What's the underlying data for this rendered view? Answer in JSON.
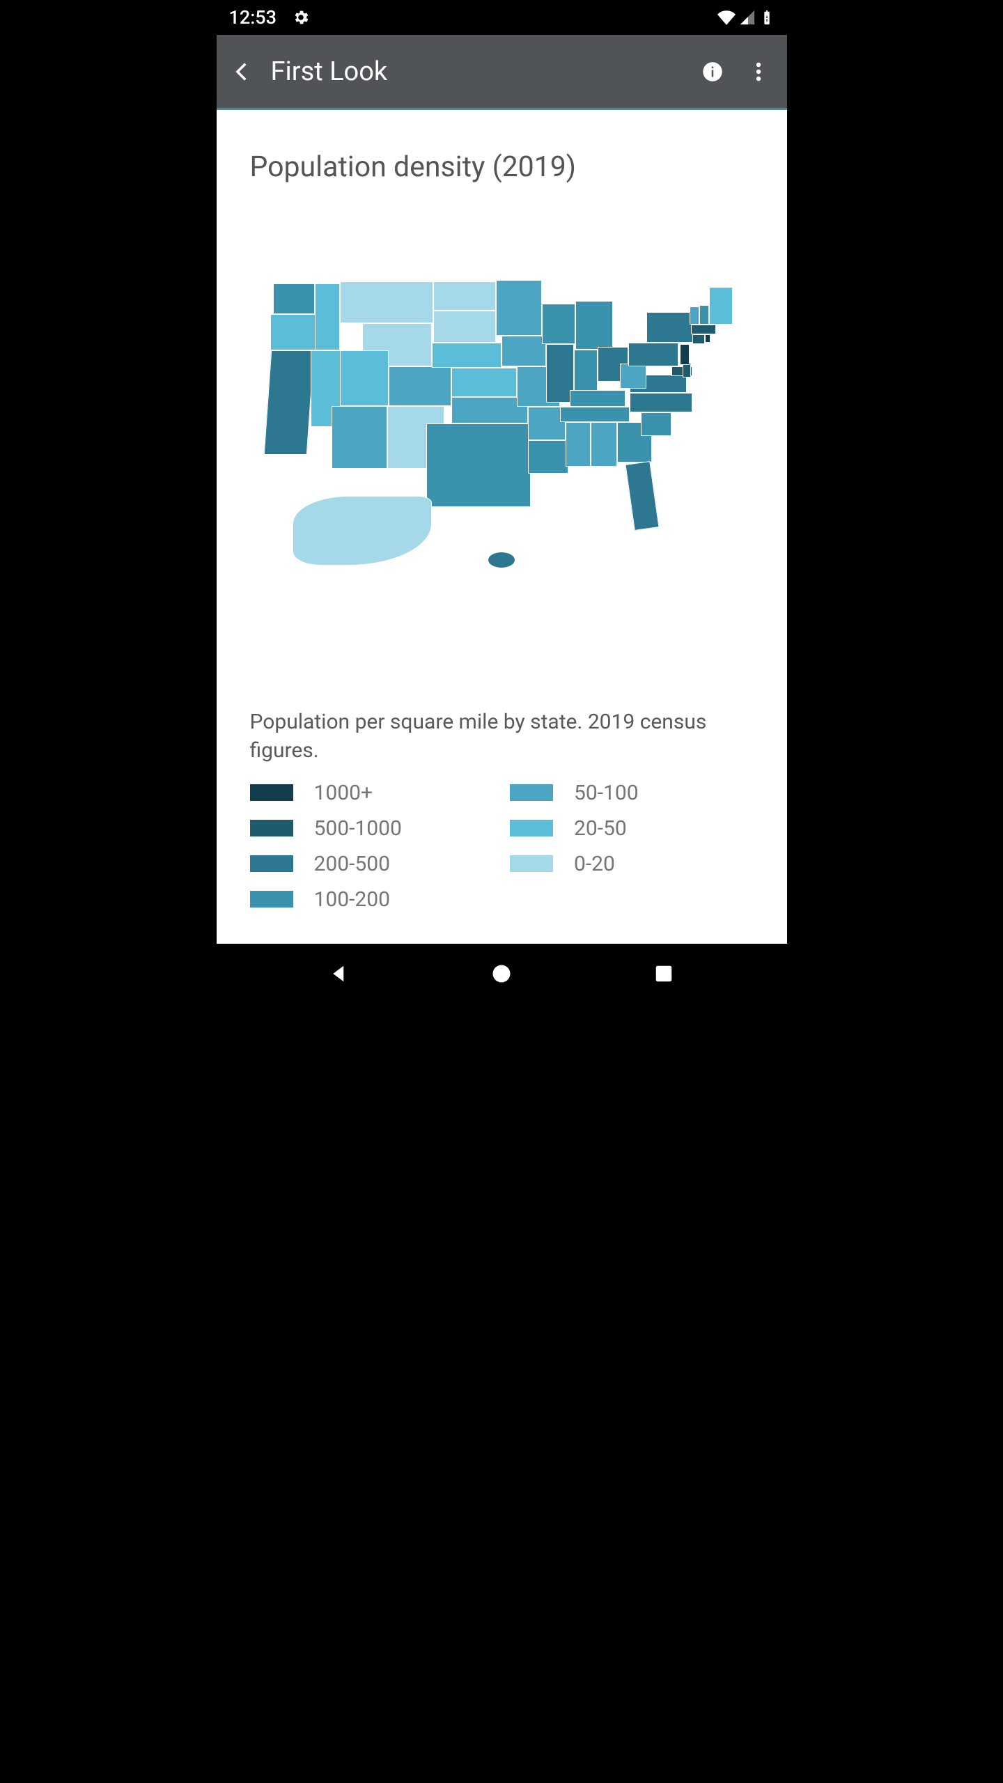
{
  "status": {
    "time": "12:53",
    "icons": [
      "settings-icon",
      "wifi-icon",
      "signal-icon",
      "battery-icon"
    ]
  },
  "appbar": {
    "title": "First Look"
  },
  "chart_data": {
    "type": "map",
    "title": "Population density (2019)",
    "legend_title": "Population per square mile by state. 2019 census figures.",
    "scale": [
      {
        "label": "1000+",
        "color": "#133c4c"
      },
      {
        "label": "500-1000",
        "color": "#1f5a6f"
      },
      {
        "label": "200-500",
        "color": "#2d7790"
      },
      {
        "label": "100-200",
        "color": "#3b92ad"
      },
      {
        "label": "50-100",
        "color": "#4ba5c3"
      },
      {
        "label": "20-50",
        "color": "#5cbdd9"
      },
      {
        "label": "0-20",
        "color": "#a5d8e8"
      }
    ],
    "geo": "US states",
    "year": 2019,
    "unit": "people per sq mi",
    "data": {
      "WA": "100-200",
      "OR": "20-50",
      "CA": "200-500",
      "NV": "20-50",
      "ID": "20-50",
      "MT": "0-20",
      "WY": "0-20",
      "UT": "20-50",
      "AZ": "50-100",
      "NM": "0-20",
      "CO": "50-100",
      "ND": "0-20",
      "SD": "0-20",
      "NE": "20-50",
      "KS": "20-50",
      "OK": "50-100",
      "TX": "100-200",
      "MN": "50-100",
      "IA": "50-100",
      "MO": "50-100",
      "AR": "50-100",
      "LA": "100-200",
      "WI": "100-200",
      "IL": "200-500",
      "MI": "100-200",
      "IN": "100-200",
      "OH": "200-500",
      "KY": "100-200",
      "TN": "100-200",
      "MS": "50-100",
      "AL": "50-100",
      "GA": "100-200",
      "FL": "200-500",
      "SC": "100-200",
      "NC": "200-500",
      "VA": "200-500",
      "WV": "50-100",
      "PA": "200-500",
      "NY": "200-500",
      "MD": "500-1000",
      "DE": "500-1000",
      "NJ": "1000+",
      "CT": "500-1000",
      "RI": "1000+",
      "MA": "500-1000",
      "VT": "50-100",
      "NH": "100-200",
      "ME": "20-50",
      "AK": "0-20",
      "HI": "200-500"
    }
  }
}
